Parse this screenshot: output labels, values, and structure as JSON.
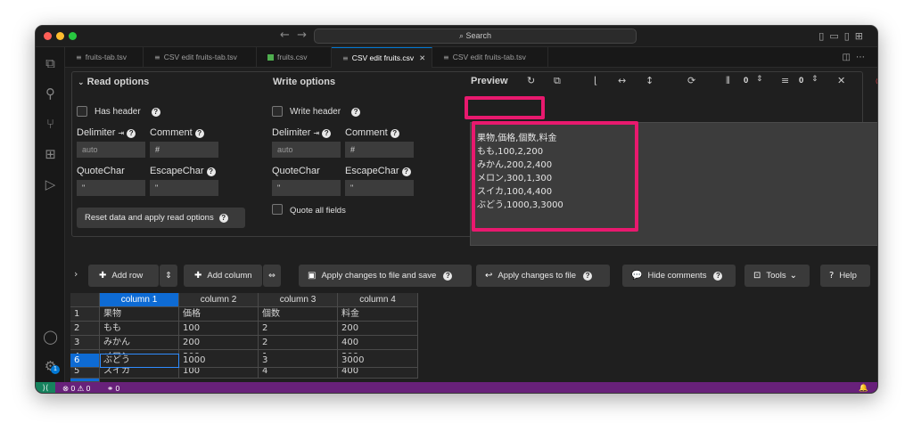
{
  "titlebar": {
    "search_placeholder": "Search",
    "nav_back": "←",
    "nav_forward": "→"
  },
  "tabs": [
    {
      "label": "fruits-tab.tsv",
      "icon": "≡",
      "active": false
    },
    {
      "label": "CSV edit fruits-tab.tsv",
      "icon": "≡",
      "active": false
    },
    {
      "label": "fruits.csv",
      "icon": "green-square",
      "active": false
    },
    {
      "label": "CSV edit fruits.csv",
      "icon": "≡",
      "active": true
    },
    {
      "label": "CSV edit fruits-tab.tsv",
      "icon": "≡",
      "active": false
    }
  ],
  "read_options": {
    "title": "Read options",
    "has_header": "Has header",
    "delimiter_label": "Delimiter",
    "delimiter_value": "auto",
    "comment_label": "Comment",
    "comment_value": "#",
    "quotechar_label": "QuoteChar",
    "quotechar_value": "\"",
    "escapechar_label": "EscapeChar",
    "escapechar_value": "\"",
    "reset_button": "Reset data and apply read options"
  },
  "write_options": {
    "title": "Write options",
    "write_header": "Write header",
    "delimiter_label": "Delimiter",
    "delimiter_value": "auto",
    "comment_label": "Comment",
    "comment_value": "#",
    "quotechar_label": "QuoteChar",
    "quotechar_value": "\"",
    "escapechar_label": "EscapeChar",
    "escapechar_value": "\"",
    "quote_all_fields": "Quote all fields"
  },
  "preview": {
    "title": "Preview",
    "col_count": "0",
    "row_count": "0",
    "lines": [
      "果物,価格,個数,料金",
      "もも,100,2,200",
      "みかん,200,2,400",
      "メロン,300,1,300",
      "スイカ,100,4,400",
      "ぶどう,1000,3,3000"
    ]
  },
  "toolbar": {
    "add_row": "Add row",
    "add_column": "Add column",
    "apply_save": "Apply changes to file and save",
    "apply": "Apply changes to file",
    "hide_comments": "Hide comments",
    "tools": "Tools",
    "help": "Help"
  },
  "table": {
    "headers": [
      "column 1",
      "column 2",
      "column 3",
      "column 4"
    ],
    "rows": [
      {
        "num": "1",
        "cells": [
          "果物",
          "価格",
          "個数",
          "料金"
        ]
      },
      {
        "num": "2",
        "cells": [
          "もも",
          "100",
          "2",
          "200"
        ]
      },
      {
        "num": "3",
        "cells": [
          "みかん",
          "200",
          "2",
          "400"
        ]
      },
      {
        "num": "4",
        "cells": [
          "メロン",
          "300",
          "1",
          "300"
        ]
      },
      {
        "num": "5",
        "cells": [
          "スイカ",
          "100",
          "4",
          "400"
        ]
      },
      {
        "num": "6",
        "cells": [
          "ぶどう",
          "1000",
          "3",
          "3000"
        ]
      }
    ]
  },
  "statusbar": {
    "errors": "0",
    "warnings": "0",
    "ports": "0"
  },
  "colors": {
    "accent": "#0e6bd4",
    "highlight": "#e8196e",
    "status": "#68217a"
  }
}
